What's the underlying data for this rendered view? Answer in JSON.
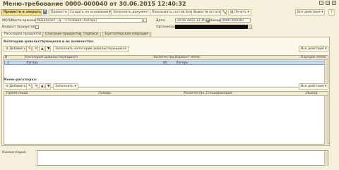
{
  "window": {
    "title": "Меню-требование 0000-000040 от 30.06.2015 12:40:32",
    "buttons": [
      "▫",
      "▭",
      "×"
    ]
  },
  "toolbar": {
    "post_close": "Провести и закрыть",
    "post": "Провести",
    "create_basis": "Создать на основании ▾",
    "fill_doc": "Заполнить документ",
    "show_dish": "Показывать состав блюд",
    "show_rest": "Вывести остатки",
    "print": "Печать ▾",
    "all_actions": "Все действия ▾",
    "help": "?"
  },
  "header": {
    "mol_label": "МОЛ/Место хранения:",
    "mol_value": "Михалков Г. Д. : Столовая (Лагерь)",
    "date_label": "Дата:",
    "date_value": "30.06.2015 12:40:32",
    "number_label": "Номер:",
    "number_value": "0000-000040",
    "org_label": "Организация:",
    "return_label": "Возврат продуктов:"
  },
  "tabs": [
    "Раскладка продуктов",
    "Списание продуктов",
    "Подписи",
    "Бухгалтерская операция"
  ],
  "categories": {
    "title": "Категории довольствующихся и их количество:",
    "add_label": "Добавить",
    "fill_label": "Заполнить категории довольствующихся",
    "all_actions": "Все действия ▾",
    "columns": [
      "N",
      "Категория довольствующихся",
      "Количество",
      "Вариант меню",
      "Порядок меню"
    ],
    "rows": [
      {
        "n": "1",
        "category": "Лагерь",
        "qty": "85",
        "variant": "Лагерь",
        "order": ""
      }
    ]
  },
  "layout_section": {
    "title": "Меню-раскладка:",
    "add_label": "Добавить",
    "fill_label": "Заполнить ▾",
    "all_actions": "Все действия ▾",
    "columns": [
      "Прием пищи",
      "Блюдо",
      "Количество",
      "Спецификация",
      "Выход"
    ]
  },
  "comment": {
    "label": "Комментарий:"
  }
}
